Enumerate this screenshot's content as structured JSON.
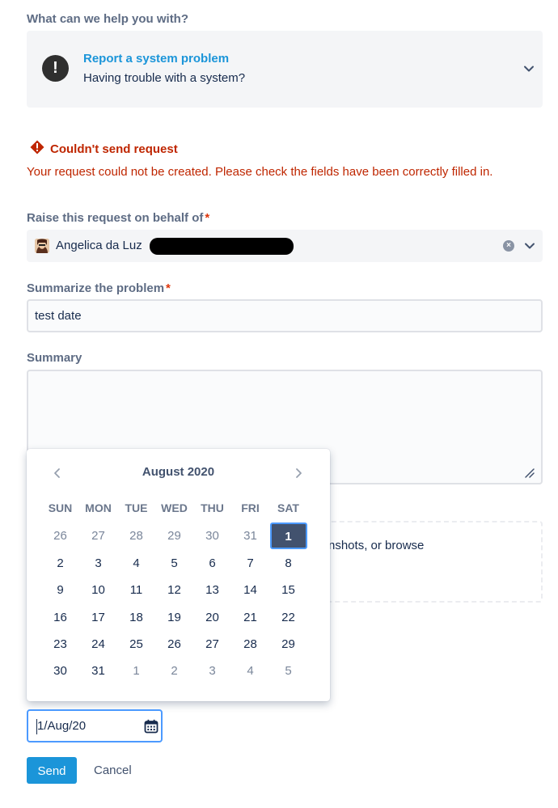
{
  "request_type": {
    "question": "What can we help you with?",
    "title": "Report a system problem",
    "subtitle": "Having trouble with a system?"
  },
  "error": {
    "title": "Couldn't send request",
    "message": "Your request could not be created. Please check the fields have been correctly filled in."
  },
  "behalf": {
    "label": "Raise this request on behalf of",
    "value": "Angelica da Luz"
  },
  "summarize": {
    "label": "Summarize the problem",
    "value": "test date"
  },
  "summary": {
    "label": "Summary",
    "value": ""
  },
  "attachment": {
    "text_partial": "nshots, or browse"
  },
  "calendar": {
    "month": "August 2020",
    "weekdays": [
      "SUN",
      "MON",
      "TUE",
      "WED",
      "THU",
      "FRI",
      "SAT"
    ],
    "weeks": [
      [
        "26",
        "27",
        "28",
        "29",
        "30",
        "31",
        "1"
      ],
      [
        "2",
        "3",
        "4",
        "5",
        "6",
        "7",
        "8"
      ],
      [
        "9",
        "10",
        "11",
        "12",
        "13",
        "14",
        "15"
      ],
      [
        "16",
        "17",
        "18",
        "19",
        "20",
        "21",
        "22"
      ],
      [
        "23",
        "24",
        "25",
        "26",
        "27",
        "28",
        "29"
      ],
      [
        "30",
        "31",
        "1",
        "2",
        "3",
        "4",
        "5"
      ]
    ],
    "selected_day": "1"
  },
  "date_field": {
    "value": "1/Aug/20"
  },
  "actions": {
    "send": "Send",
    "cancel": "Cancel"
  },
  "colors": {
    "link": "#1b95d9",
    "error": "#bf2600",
    "required": "#de350b",
    "selected_day": "#42526e",
    "focus": "#4c9aff"
  }
}
